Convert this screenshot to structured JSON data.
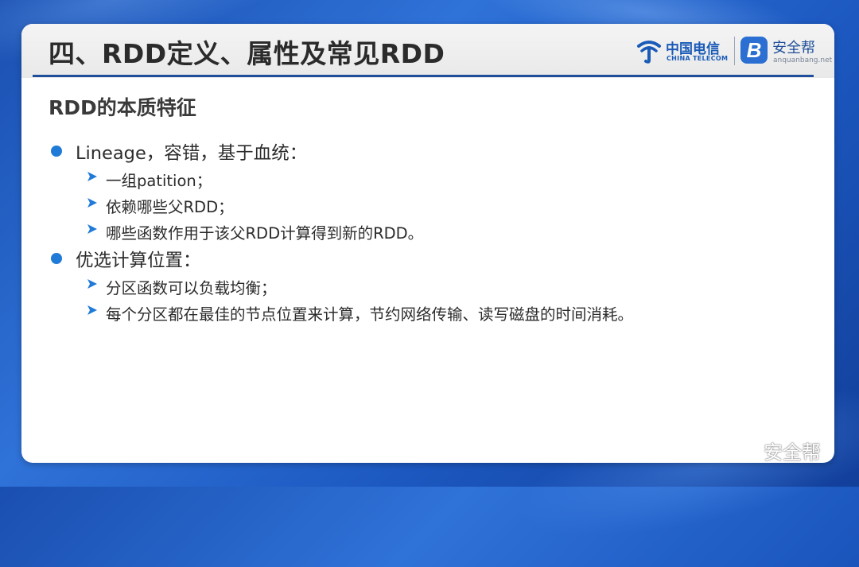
{
  "slide": {
    "title": "四、RDD定义、属性及常见RDD",
    "subtitle": "RDD的本质特征"
  },
  "logos": {
    "telecom_cn": "中国电信",
    "telecom_en": "CHINA TELECOM",
    "aqb_cn": "安全帮",
    "aqb_en": "anquanbang.net",
    "aqb_mark": "B"
  },
  "bullets": [
    {
      "text": "Lineage，容错，基于血统：",
      "items": [
        "一组patition；",
        "依赖哪些父RDD；",
        "哪些函数作用于该父RDD计算得到新的RDD。"
      ]
    },
    {
      "text": "优选计算位置：",
      "items": [
        "分区函数可以负载均衡；",
        "每个分区都在最佳的节点位置来计算，节约网络传输、读写磁盘的时间消耗。"
      ]
    }
  ],
  "watermark": {
    "text": "安全帮",
    "icon": "wechat-icon"
  },
  "colors": {
    "accent": "#1f7ad8",
    "rule": "#1f4f9a",
    "background": "#2f72d8"
  }
}
